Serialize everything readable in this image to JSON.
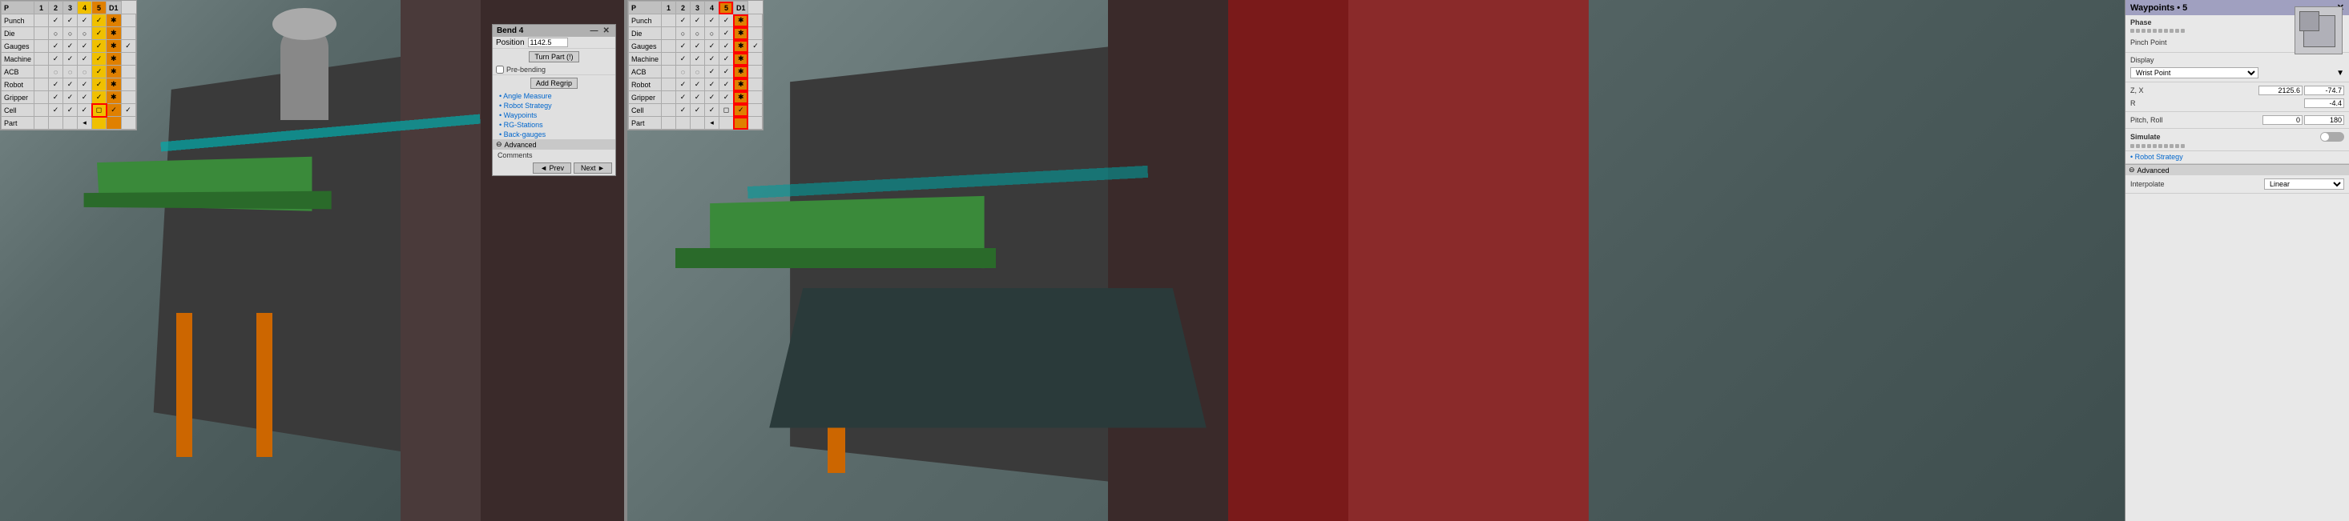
{
  "left": {
    "grid": {
      "columns": [
        "P",
        "1",
        "2",
        "3",
        "4",
        "5",
        "D1"
      ],
      "rows": [
        {
          "label": "Punch",
          "cells": [
            "",
            "✓",
            "✓",
            "✓",
            "✓",
            "✱",
            ""
          ]
        },
        {
          "label": "Die",
          "cells": [
            "",
            "○",
            "○",
            "○",
            "✓",
            "✱",
            ""
          ]
        },
        {
          "label": "Gauges",
          "cells": [
            "",
            "✓",
            "✓",
            "✓",
            "✓",
            "✱",
            "✓"
          ]
        },
        {
          "label": "Machine",
          "cells": [
            "",
            "✓",
            "✓",
            "✓",
            "✓",
            "✱",
            ""
          ]
        },
        {
          "label": "ACB",
          "cells": [
            "",
            "◌",
            "◌",
            "◌",
            "✓",
            "✱",
            ""
          ]
        },
        {
          "label": "Robot",
          "cells": [
            "",
            "✓",
            "✓",
            "✓",
            "✓",
            "✱",
            ""
          ]
        },
        {
          "label": "Gripper",
          "cells": [
            "",
            "✓",
            "✓",
            "✓",
            "✓",
            "✱",
            ""
          ]
        },
        {
          "label": "Cell",
          "cells": [
            "",
            "✓",
            "✓",
            "✓",
            "◻",
            "✓",
            "✓"
          ]
        },
        {
          "label": "Part",
          "cells": [
            "",
            "",
            "",
            "◂",
            "",
            "",
            ""
          ]
        }
      ],
      "highlight_col": 4,
      "red_border_col": 4,
      "red_border_row": 7
    },
    "bend_panel": {
      "title": "Bend 4",
      "position_label": "Position",
      "position_value": "1142.5",
      "turn_part_btn": "Turn Part (!)",
      "pre_bending_label": "Pre-bending",
      "add_regrip_btn": "Add Regrip",
      "links": [
        "Angle Measure",
        "Robot Strategy",
        "Waypoints",
        "RG-Stations",
        "Back-gauges"
      ],
      "advanced_label": "Advanced",
      "comments_label": "Comments",
      "prev_btn": "◄ Prev",
      "next_btn": "Next ►"
    }
  },
  "right": {
    "grid": {
      "columns": [
        "P",
        "1",
        "2",
        "3",
        "4",
        "5",
        "D1"
      ],
      "rows": [
        {
          "label": "Punch",
          "cells": [
            "",
            "✓",
            "✓",
            "✓",
            "✓",
            "✱",
            ""
          ]
        },
        {
          "label": "Die",
          "cells": [
            "",
            "○",
            "○",
            "○",
            "✓",
            "✱",
            ""
          ]
        },
        {
          "label": "Gauges",
          "cells": [
            "",
            "✓",
            "✓",
            "✓",
            "✓",
            "✱",
            "✓"
          ]
        },
        {
          "label": "Machine",
          "cells": [
            "",
            "✓",
            "✓",
            "✓",
            "✓",
            "✱",
            ""
          ]
        },
        {
          "label": "ACB",
          "cells": [
            "",
            "◌",
            "◌",
            "✓",
            "✓",
            "✱",
            ""
          ]
        },
        {
          "label": "Robot",
          "cells": [
            "",
            "✓",
            "✓",
            "✓",
            "✓",
            "✱",
            ""
          ]
        },
        {
          "label": "Gripper",
          "cells": [
            "",
            "✓",
            "✓",
            "✓",
            "✓",
            "✱",
            ""
          ]
        },
        {
          "label": "Cell",
          "cells": [
            "",
            "✓",
            "✓",
            "✓",
            "◻",
            "✓",
            ""
          ]
        },
        {
          "label": "Part",
          "cells": [
            "",
            "",
            "",
            "◂",
            "",
            "",
            ""
          ]
        }
      ],
      "highlight_col": 5,
      "red_border_col": 5
    },
    "waypoints_panel": {
      "title": "Waypoints • 5",
      "phase_label": "Phase",
      "pinch_point_label": "Pinch Point",
      "display_label": "Display",
      "display_value": "Wrist Point",
      "zx_label": "Z, X",
      "z_value": "2125.6",
      "x_value": "-74.7",
      "r_label": "R",
      "r_value": "-4.4",
      "pitch_roll_label": "Pitch, Roll",
      "pitch_value": "0",
      "roll_value": "180",
      "simulate_label": "Simulate",
      "robot_strategy_link": "Robot Strategy",
      "advanced_label": "Advanced",
      "interpolate_label": "Interpolate",
      "interpolate_value": "Linear",
      "close_btn": "✕",
      "minimize_btn": "—"
    }
  }
}
